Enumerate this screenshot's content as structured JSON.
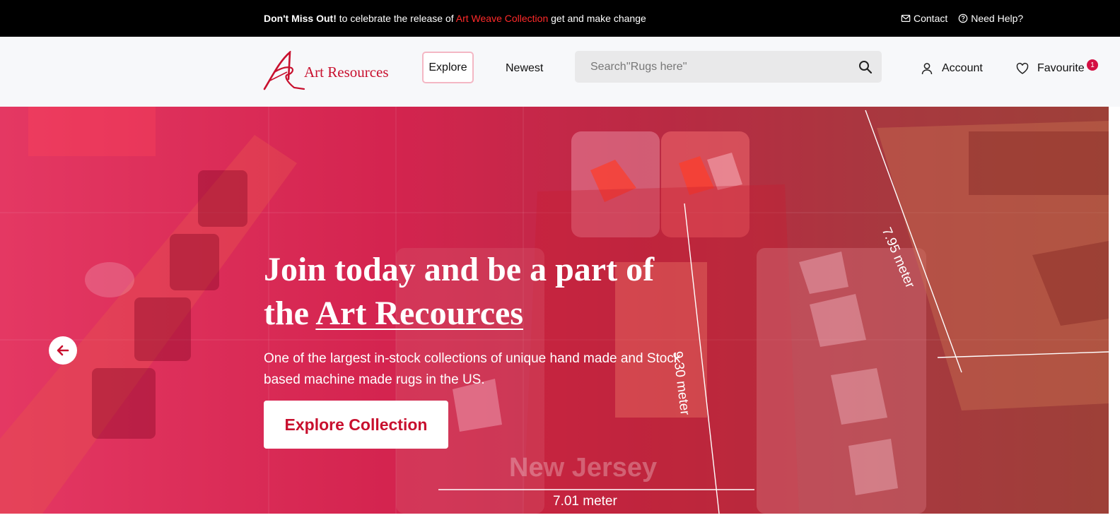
{
  "topbar": {
    "promo_bold": "Don't Miss Out!",
    "promo_pre": " to celebrate the release of ",
    "promo_highlight": "Art Weave Collection",
    "promo_post": " get and make change",
    "contact_label": "Contact",
    "help_label": "Need Help?",
    "highlight_color": "#ff2a2a"
  },
  "header": {
    "logo_text": "Art Resources",
    "nav": {
      "explore": "Explore",
      "newest": "Newest"
    },
    "search": {
      "placeholder": "Search''Rugs here''",
      "icon": "search-icon"
    },
    "account_label": "Account",
    "favourite_label": "Favourite",
    "favourite_count": "1",
    "brand_color": "#c8102e"
  },
  "hero": {
    "title_line1": "Join today and be a part of",
    "title_the": "the ",
    "title_brand": "Art Recources",
    "subtitle": "One of the largest in-stock collections of unique hand made and Stock based machine made rugs in the US.",
    "cta_label": "Explore Collection",
    "watermark": "New Jersey",
    "dimensions": {
      "bottom": "7.01 meter",
      "middle": "9.30 meter",
      "right": "7.95 meter"
    },
    "prev_icon": "arrow-left-icon"
  }
}
